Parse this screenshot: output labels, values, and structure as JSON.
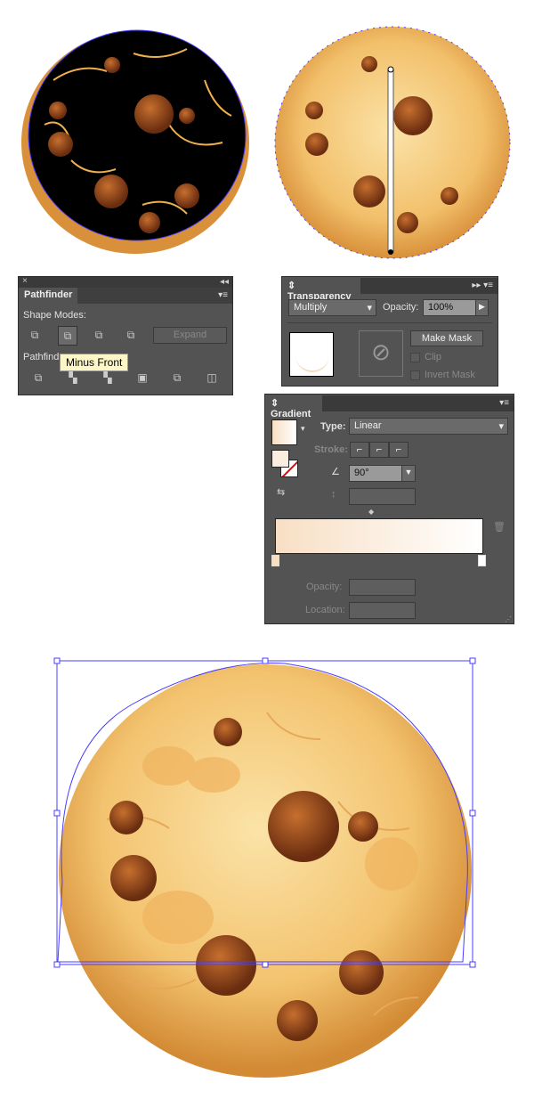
{
  "pathfinder": {
    "close": "×",
    "collapse": "◂◂",
    "tab": "Pathfinder",
    "menu": "▾≡",
    "shape_modes_label": "Shape Modes:",
    "expand_label": "Expand",
    "pathfinders_label": "Pathfind",
    "tooltip": "Minus Front",
    "shape_mode_icons": [
      "unite-icon",
      "minus-front-icon",
      "intersect-icon",
      "exclude-icon"
    ],
    "pathfinder_icons": [
      "divide-icon",
      "trim-icon",
      "merge-icon",
      "crop-icon",
      "outline-icon",
      "minus-back-icon"
    ]
  },
  "transparency": {
    "tab": "Transparency",
    "blend_mode": "Multiply",
    "opacity_label": "Opacity:",
    "opacity_value": "100%",
    "make_mask_label": "Make Mask",
    "clip_label": "Clip",
    "invert_mask_label": "Invert Mask",
    "menu": "▸▸ ▾≡"
  },
  "gradient": {
    "tab": "Gradient",
    "menu": "▾≡",
    "type_label": "Type:",
    "type_value": "Linear",
    "stroke_label": "Stroke:",
    "angle_value": "90°",
    "opacity_label": "Opacity:",
    "location_label": "Location:",
    "start_color": "#f8dfc4",
    "end_color": "#ffffff"
  },
  "colors": {
    "cookie_light": "#fbe3a8",
    "cookie_mid": "#f0b659",
    "cookie_edge": "#d9903a",
    "chip": "#7a3a18",
    "selection": "#4a3cff"
  }
}
